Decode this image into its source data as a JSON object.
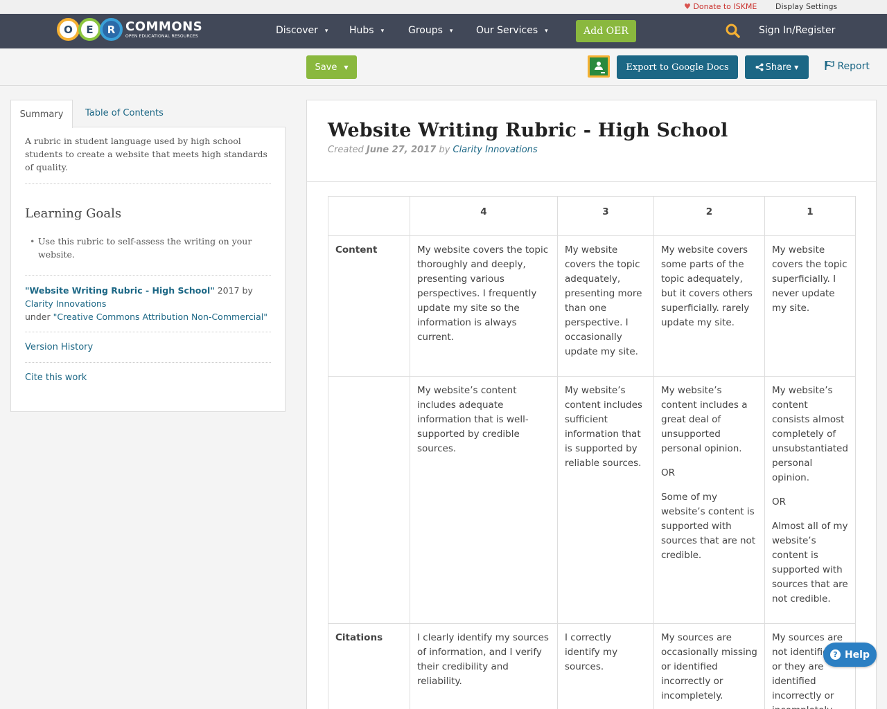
{
  "util": {
    "donate_label": "Donate to ISKME",
    "display_settings": "Display Settings"
  },
  "logo": {
    "letters": [
      "O",
      "E",
      "R"
    ],
    "wordmark": "COMMONS",
    "tagline": "OPEN EDUCATIONAL RESOURCES"
  },
  "nav": {
    "items": [
      {
        "label": "Discover"
      },
      {
        "label": "Hubs"
      },
      {
        "label": "Groups"
      },
      {
        "label": "Our Services"
      }
    ],
    "add_oer": "Add OER",
    "signin": "Sign In/Register"
  },
  "toolbar": {
    "save": "Save",
    "export": "Export to Google Docs",
    "share": "Share",
    "report": "Report"
  },
  "sidebar": {
    "tab_summary": "Summary",
    "tab_toc": "Table of Contents",
    "summary": "A rubric in student language used by high school students to create a website that meets high standards of quality.",
    "goals_title": "Learning Goals",
    "goals": [
      "Use this rubric to self-assess the writing on your website."
    ],
    "attrib_title": "\"Website Writing Rubric - High School\"",
    "attrib_year_by": " 2017 by ",
    "attrib_author": "Clarity Innovations",
    "attrib_under": "under ",
    "attrib_license": "\"Creative Commons Attribution Non-Commercial\"",
    "version_history": "Version History",
    "cite": "Cite this work"
  },
  "doc": {
    "title": "Website Writing Rubric - High School",
    "created_label": "Created ",
    "date": "June 27, 2017",
    "by_label": " by ",
    "author": "Clarity Innovations"
  },
  "rubric": {
    "headers": [
      "",
      "4",
      "3",
      "2",
      "1"
    ],
    "rows": [
      {
        "label": "Content",
        "cells": [
          [
            "My website covers the topic thoroughly and deeply, presenting various perspectives. I frequently update my site so the information is always current."
          ],
          [
            "My website covers the topic adequately, presenting more than one perspective. I occasionally update my site."
          ],
          [
            "My website covers some parts of the topic adequately, but it covers others superficially.   rarely update my site."
          ],
          [
            "My website covers the topic superficially. I never update my site."
          ]
        ]
      },
      {
        "label": "",
        "cells": [
          [
            "My website’s content includes adequate information that is well-supported by credible sources."
          ],
          [
            "My website’s content includes sufficient information that is supported by reliable sources."
          ],
          [
            "My website’s content includes a great deal of unsupported personal opinion.",
            "OR",
            "Some of my website’s content is supported with sources that are not credible."
          ],
          [
            "My website’s content consists almost completely of unsubstantiated personal opinion.",
            "OR",
            "Almost all of my website’s content is supported with sources that are not credible."
          ]
        ]
      },
      {
        "label": "Citations",
        "cells": [
          [
            "I clearly identify my sources of information, and I verify their credibility and reliability."
          ],
          [
            "I correctly identify my sources."
          ],
          [
            "My sources are occasionally missing or identified incorrectly or incompletely."
          ],
          [
            "My sources are not identified, or they are identified incorrectly or incompletely."
          ]
        ]
      }
    ]
  },
  "help": "Help",
  "colors": {
    "nav_bg": "#414858",
    "green": "#8ab83e",
    "blue": "#1c6785",
    "donate_red": "#c9302c"
  }
}
